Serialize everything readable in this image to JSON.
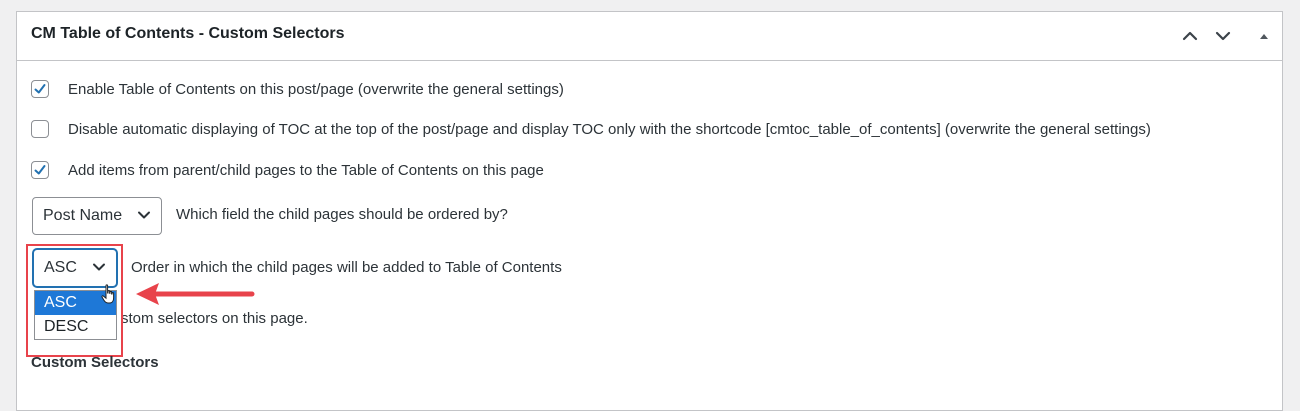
{
  "panel": {
    "title": "CM Table of Contents - Custom Selectors",
    "controls": [
      "chevron-up-icon",
      "chevron-down-icon",
      "collapse-triangle-icon"
    ]
  },
  "options": [
    {
      "checked": true,
      "label": "Enable Table of Contents on this post/page (overwrite the general settings)"
    },
    {
      "checked": false,
      "label": "Disable automatic displaying of TOC at the top of the post/page and display TOC only with the shortcode [cmtoc_table_of_contents] (overwrite the general settings)"
    },
    {
      "checked": true,
      "label": "Add items from parent/child pages to the Table of Contents on this page"
    }
  ],
  "order_field": {
    "value": "Post Name",
    "label": "Which field the child pages should be ordered by?"
  },
  "order_direction": {
    "value": "ASC",
    "label": "Order in which the child pages will be added to Table of Contents",
    "options": [
      "ASC",
      "DESC"
    ],
    "selected_option": "ASC"
  },
  "partial_text": "stom selectors on this page.",
  "section_title": "Custom Selectors",
  "colors": {
    "checkbox_check": "#2271b1",
    "highlight": "#e8434b",
    "dropdown_selected": "#1e78d7"
  }
}
